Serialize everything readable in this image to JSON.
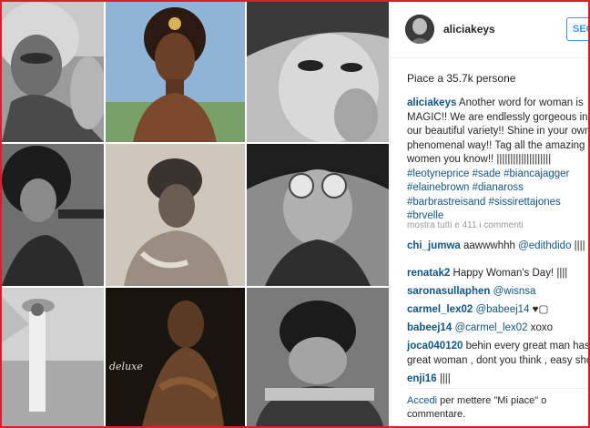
{
  "post": {
    "username": "aliciakeys",
    "follow_label": "SEG",
    "likes": "Piace a 35.7k persone"
  },
  "caption": {
    "user": "aliciakeys",
    "lines": [
      "Another word for woman is",
      "MAGIC!! We are endlessly gorgeous in a",
      "our beautiful variety!! Shine in your own",
      "phenomenal way!! Tag all the amazing",
      "women you know!! ||||||||||||||||||||"
    ],
    "tag_lines": [
      "#leotyneprice #sade #biancajagger",
      "#elainebrown #dianaross",
      "#barbrastreisand #sissirettajones",
      "#brvelle"
    ]
  },
  "view_all_comments": "mostra tutti e 411 i commenti",
  "comments": [
    {
      "user": "chi_jumwa",
      "text": "aawwwhhh ",
      "mention": "@edithdido",
      "suffix": " ||||"
    },
    {
      "user": "",
      "text": "",
      "mention": "",
      "suffix": ""
    },
    {
      "user": "renatak2",
      "text": "Happy Woman's Day! ||||",
      "mention": "",
      "suffix": ""
    },
    {
      "user": "saronasullaphen",
      "text": "",
      "mention": "@wisnsa",
      "suffix": ""
    },
    {
      "user": "carmel_lex02",
      "text": "",
      "mention": "@babeej14",
      "suffix": " ♥▢"
    },
    {
      "user": "babeej14",
      "text": "",
      "mention": "@carmel_lex02",
      "suffix": " xoxo"
    },
    {
      "user": "joca040120",
      "text": "behin every great man has",
      "mention": "",
      "suffix": ""
    },
    {
      "user": "",
      "text": "great woman , dont you think , easy sho",
      "mention": "",
      "suffix": ""
    },
    {
      "user": "enji16",
      "text": "||||",
      "mention": "",
      "suffix": ""
    }
  ],
  "login_note": {
    "link": "Accedi",
    "text": " per mettere \"Mi piace\" o commentare."
  },
  "collage": {
    "album_label": "deluxe"
  },
  "colors": {
    "frame": "#d9202a",
    "link": "#125688",
    "follow": "#3897f0",
    "muted": "#999999"
  }
}
